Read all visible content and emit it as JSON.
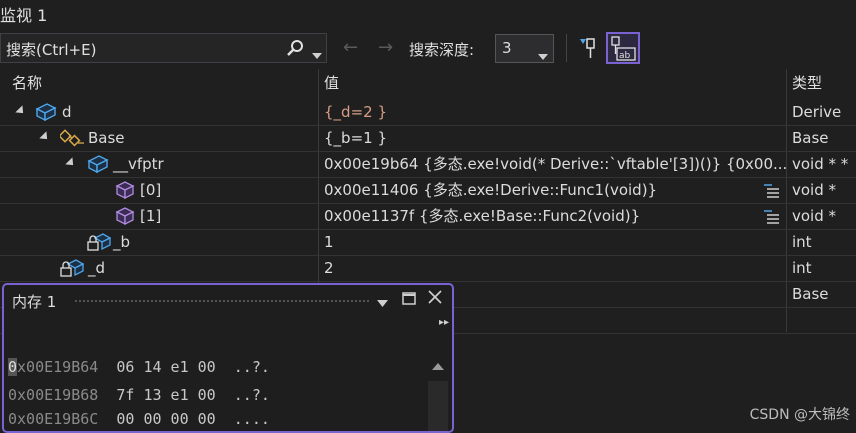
{
  "window": {
    "title": "监视 1"
  },
  "toolbar": {
    "search_placeholder": "搜索(Ctrl+E)",
    "depth_label": "搜索深度:",
    "depth_value": "3"
  },
  "grid": {
    "headers": {
      "name": "名称",
      "value": "值",
      "type": "类型"
    },
    "rows": [
      {
        "name": "d",
        "value": "{_d=2 }",
        "type": "Derive"
      },
      {
        "name": "Base",
        "value": "{_b=1 }",
        "type": "Base"
      },
      {
        "name": "__vfptr",
        "value": "0x00e19b64 {多态.exe!void(* Derive::`vftable'[3])()} {0x00...",
        "type": "void * *"
      },
      {
        "name": "[0]",
        "value": "0x00e11406 {多态.exe!Derive::Func1(void)}",
        "type": "void *"
      },
      {
        "name": "[1]",
        "value": "0x00e1137f {多态.exe!Base::Func2(void)}",
        "type": "void *"
      },
      {
        "name": "_b",
        "value": "1",
        "type": "int"
      },
      {
        "name": "_d",
        "value": "2",
        "type": "int"
      },
      {
        "name": "",
        "value": "",
        "type": "Base"
      }
    ]
  },
  "memory": {
    "title": "内存 1",
    "rows": [
      {
        "address": "0x00E19B64",
        "bytes": "06 14 e1 00",
        "ascii": "..?."
      },
      {
        "address": "0x00E19B68",
        "bytes": "7f 13 e1 00",
        "ascii": "..?."
      },
      {
        "address": "0x00E19B6C",
        "bytes": "00 00 00 00",
        "ascii": "...."
      }
    ]
  },
  "watermark": "CSDN @大锦终",
  "colors": {
    "accent": "#7a63d1",
    "value_changed": "#d69d85",
    "background": "#1f1f1f"
  }
}
